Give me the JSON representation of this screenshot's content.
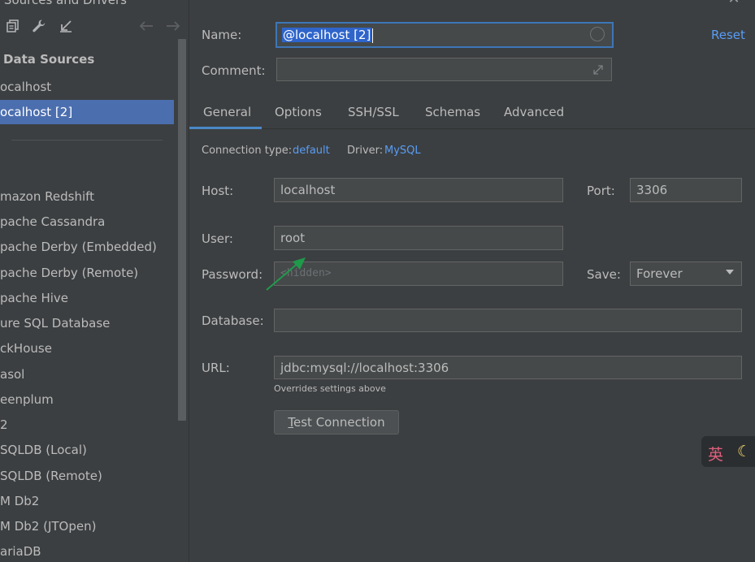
{
  "window": {
    "title_fragment": "l Sources and Drivers"
  },
  "toolbar": {
    "icons": [
      "copy-icon",
      "wrench-icon",
      "import-icon",
      "back-arrow-icon",
      "forward-arrow-icon"
    ]
  },
  "sidebar": {
    "section_title": "Data Sources",
    "data_sources": [
      "ocalhost",
      "ocalhost [2]"
    ],
    "selected_index": 1,
    "drivers": [
      "mazon Redshift",
      "pache Cassandra",
      "pache Derby (Embedded)",
      "pache Derby (Remote)",
      "pache Hive",
      "ure SQL Database",
      "ckHouse",
      "asol",
      "eenplum",
      "2",
      "SQLDB (Local)",
      "SQLDB (Remote)",
      "M Db2",
      "M Db2 (JTOpen)",
      "ariaDB"
    ]
  },
  "form": {
    "name_label": "Name:",
    "name_value": "@localhost [2]",
    "comment_label": "Comment:",
    "comment_value": "",
    "reset_label": "Reset",
    "tabs": [
      "General",
      "Options",
      "SSH/SSL",
      "Schemas",
      "Advanced"
    ],
    "active_tab": "General",
    "connection_type_label": "Connection type:",
    "connection_type_value": "default",
    "driver_label": "Driver:",
    "driver_value": "MySQL",
    "host_label": "Host:",
    "host_value": "localhost",
    "port_label": "Port:",
    "port_value": "3306",
    "user_label": "User:",
    "user_value": "root",
    "password_label": "Password:",
    "password_placeholder": "<hidden>",
    "save_label": "Save:",
    "save_value": "Forever",
    "database_label": "Database:",
    "database_value": "",
    "url_label": "URL:",
    "url_value": "jdbc:mysql://localhost:3306",
    "url_hint": "Overrides settings above",
    "test_button_first": "T",
    "test_button_rest": "est Connection"
  },
  "ime": {
    "char": "英"
  },
  "colors": {
    "background": "#3c3f41",
    "selection": "#4b6eaf",
    "link": "#589df6",
    "tab_underline": "#4a88c7",
    "annotation_arrow": "#1f9a4b"
  }
}
